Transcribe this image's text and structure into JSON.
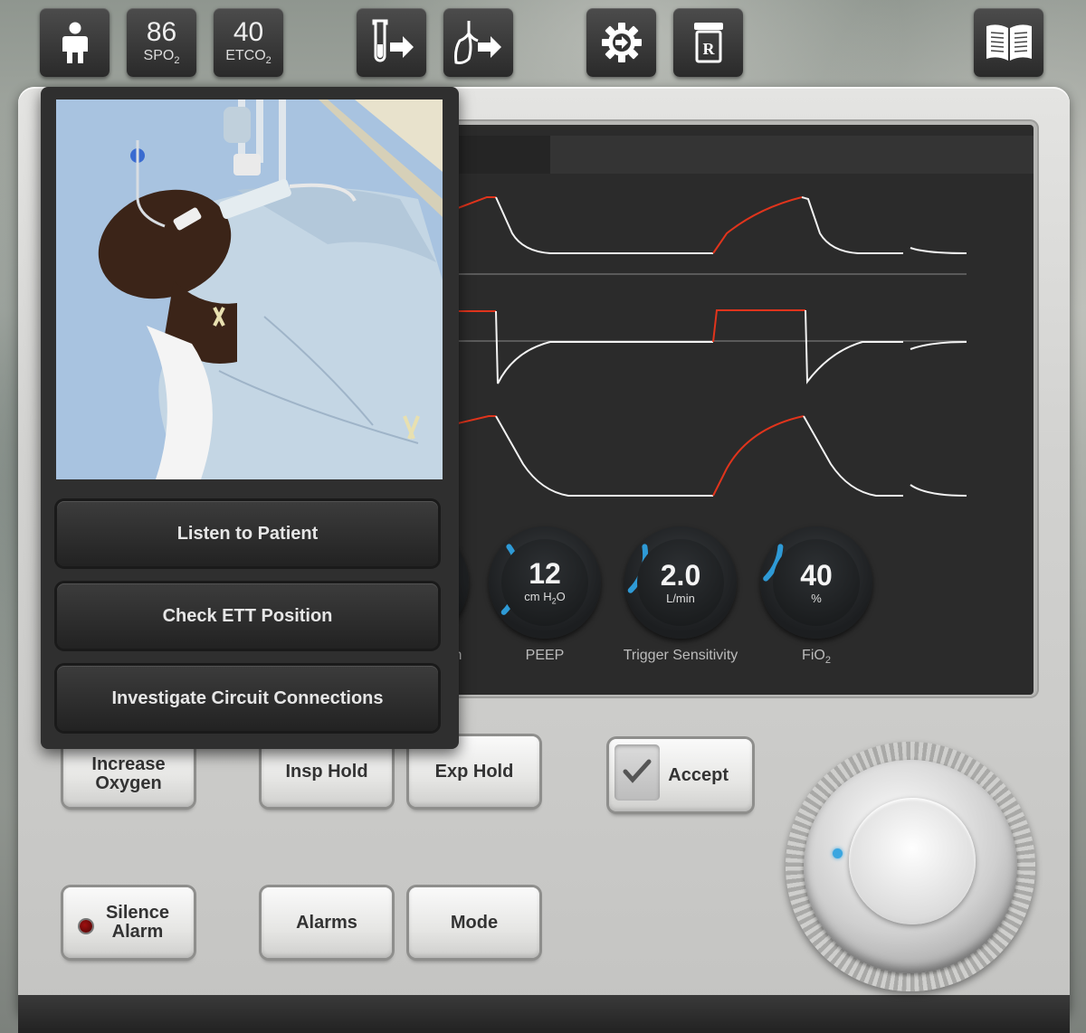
{
  "toolbar": {
    "patient_icon": "person-icon",
    "spo2": {
      "value": "86",
      "label": "SPO",
      "sub": "2"
    },
    "etco2": {
      "value": "40",
      "label": "ETCO",
      "sub": "2"
    },
    "labs_icon": "test-tube-arrow-icon",
    "lungs_icon": "lungs-arrow-icon",
    "settings_icon": "gear-arrow-icon",
    "rx_icon": "prescription-icon",
    "book_icon": "open-book-icon"
  },
  "patient_panel": {
    "image_alt": "patient-image",
    "buttons": [
      {
        "label": "Listen to Patient"
      },
      {
        "label": "Check ETT Position"
      },
      {
        "label": "Investigate Circuit Connections"
      }
    ]
  },
  "screen": {
    "partial_label": "h",
    "knobs": [
      {
        "value": "12",
        "unit": "cm H",
        "unit_sub": "2",
        "unit_tail": "O",
        "label": "PEEP",
        "level": 0.3
      },
      {
        "value": "2.0",
        "unit": "L/min",
        "label": "Trigger Sensitivity",
        "level": 0.2
      },
      {
        "value": "40",
        "unit": "%",
        "label": "FiO",
        "label_sub": "2",
        "level": 0.15
      }
    ]
  },
  "controls": {
    "increase_oxygen": "Increase Oxygen",
    "insp_hold": "Insp Hold",
    "exp_hold": "Exp Hold",
    "accept": "Accept",
    "silence_alarm": "Silence Alarm",
    "alarms": "Alarms",
    "mode": "Mode"
  },
  "colors": {
    "accent_blue": "#2e9ad6",
    "wave_white": "#f2f2f2",
    "wave_red": "#e0341c",
    "alarm_led": "#a01010"
  }
}
